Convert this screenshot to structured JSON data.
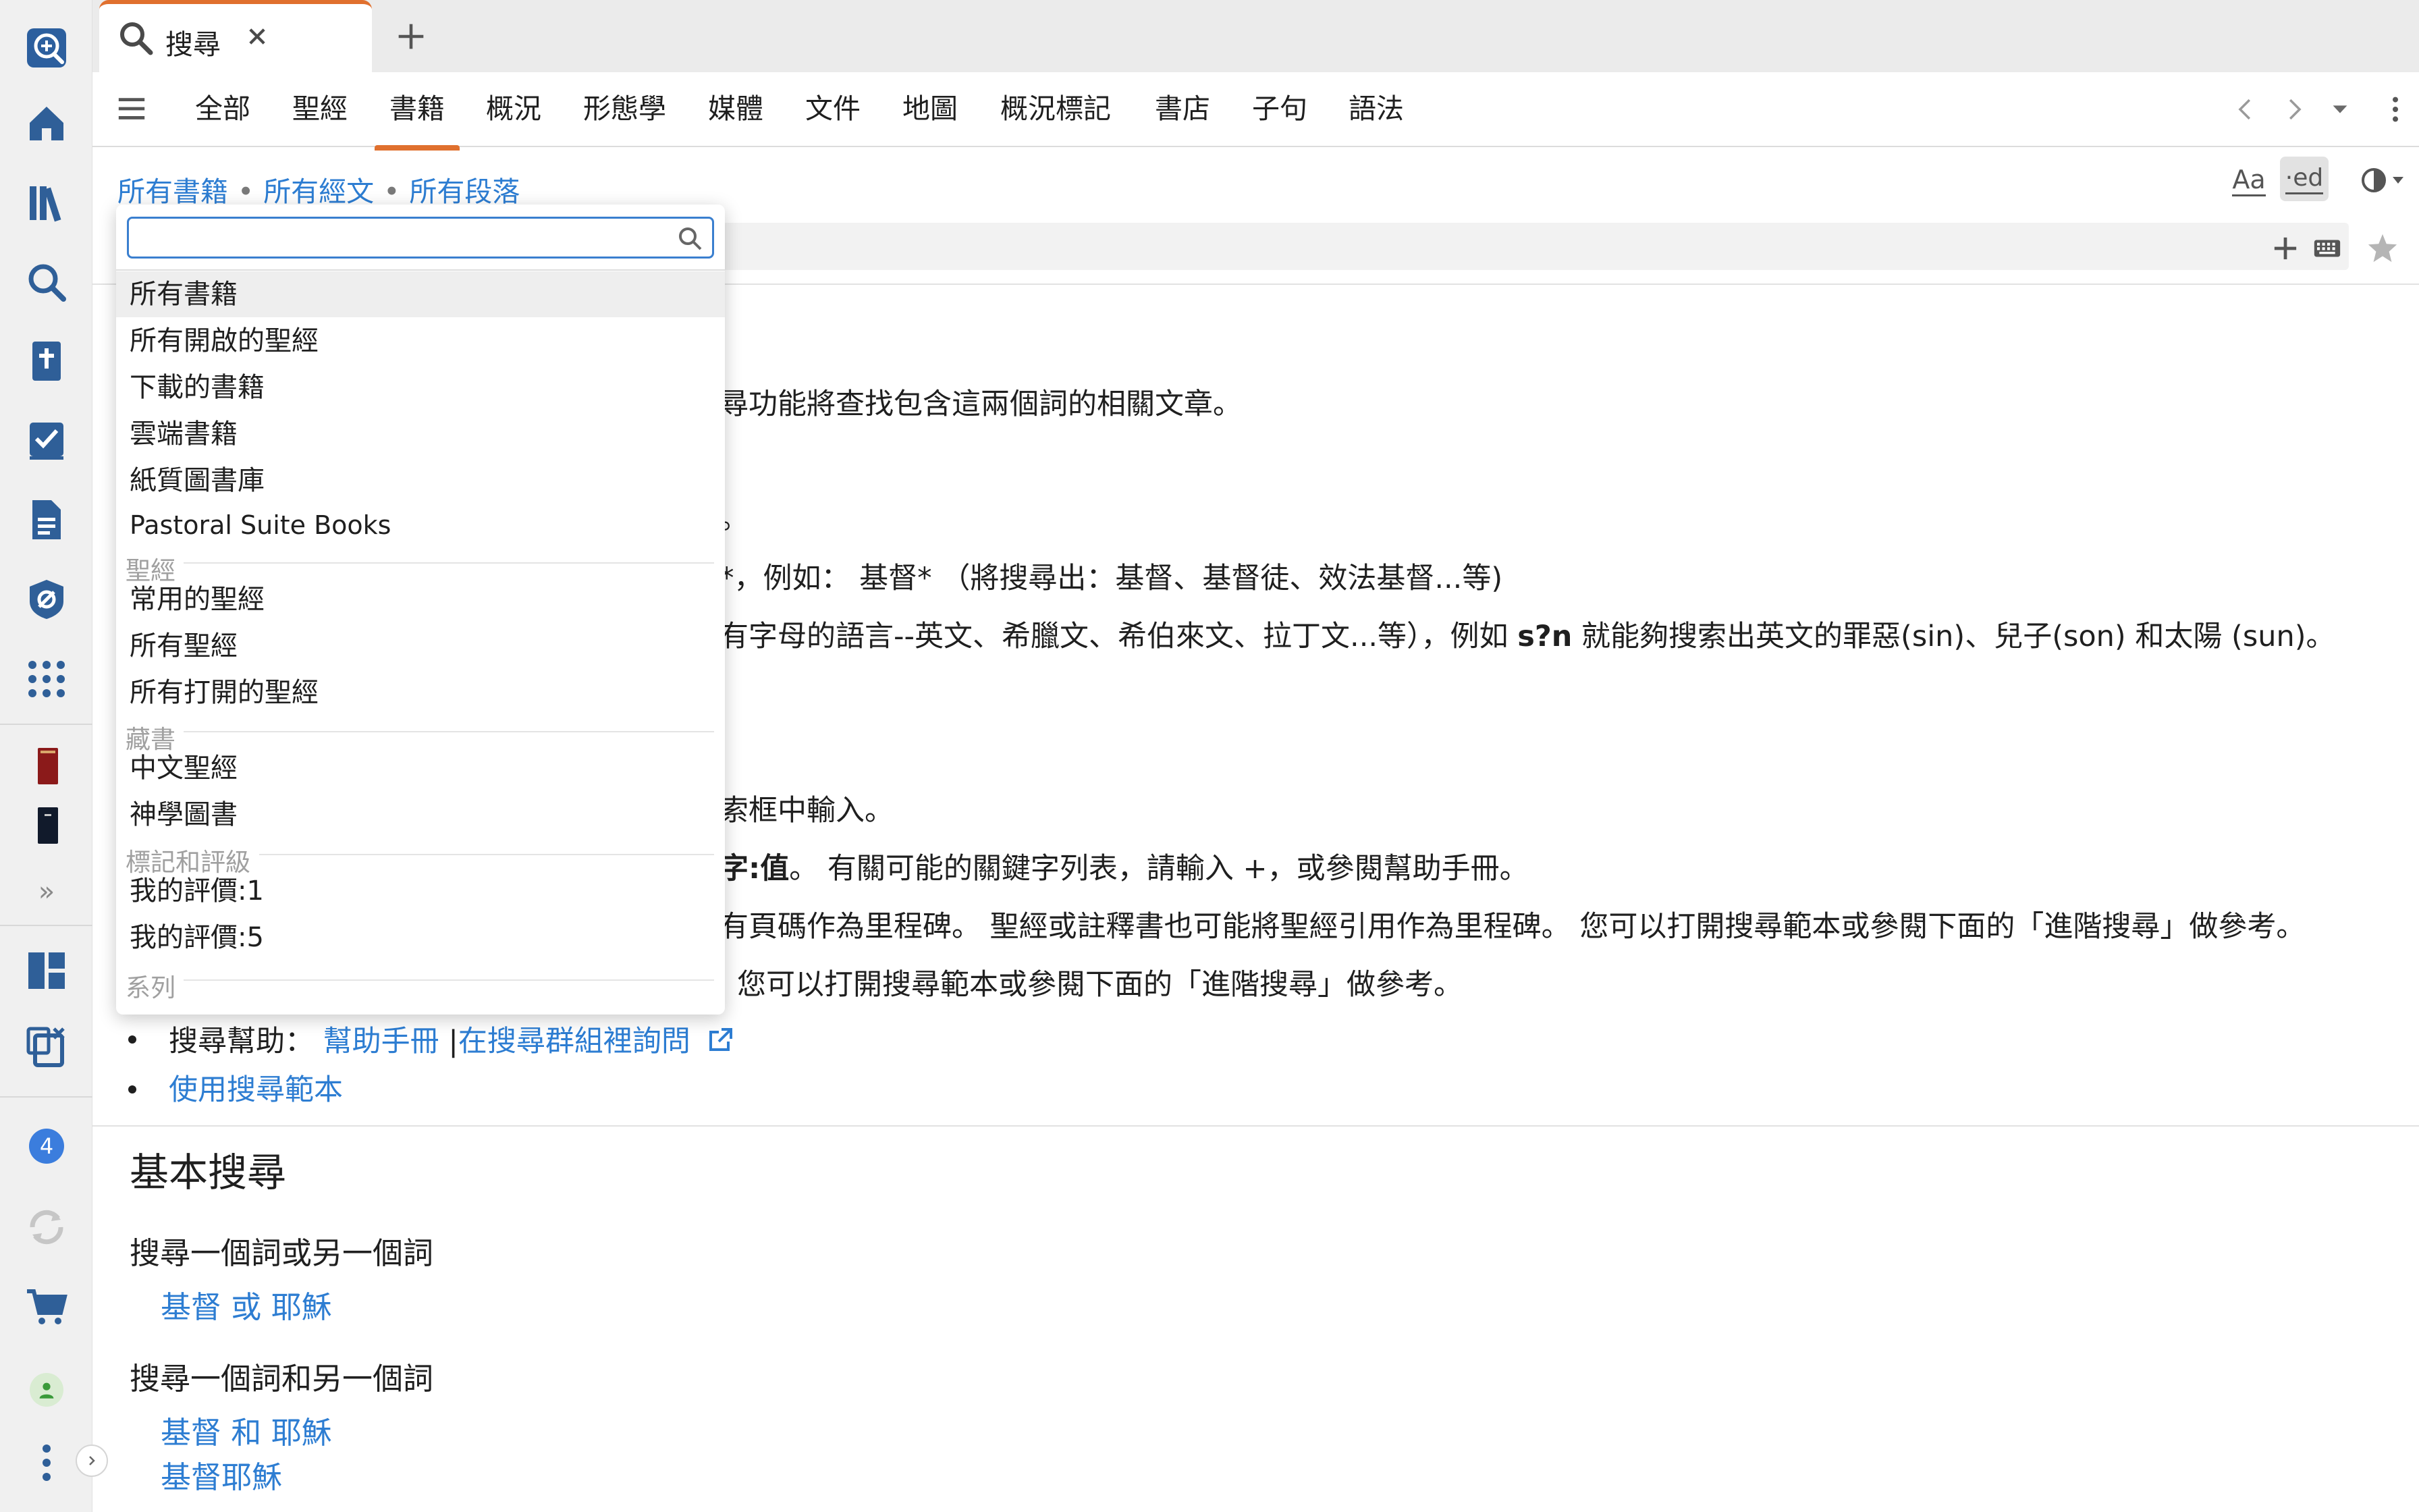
{
  "tab": {
    "search_label": "搜尋",
    "close_icon": "close-icon",
    "new_tab_icon": "plus-icon"
  },
  "nav": {
    "tabs": [
      "全部",
      "聖經",
      "書籍",
      "概況",
      "形態學",
      "媒體",
      "文件",
      "地圖",
      "概況標記",
      "書店",
      "子句",
      "語法"
    ],
    "active_index": 2
  },
  "breadcrumb": {
    "items": [
      "所有書籍",
      "所有經文",
      "所有段落"
    ],
    "separator": "•"
  },
  "toolbar": {
    "font_label": "Aa",
    "ed_label": "·ed"
  },
  "sidebar": {
    "notification_count": "4",
    "more_label": "»"
  },
  "dropdown": {
    "search_value": "",
    "search_placeholder": "",
    "items_top": [
      "所有書籍",
      "所有開啟的聖經",
      "下載的書籍",
      "雲端書籍",
      "紙質圖書庫",
      "Pastoral Suite Books"
    ],
    "group_bible": "聖經",
    "items_bible": [
      "常用的聖經",
      "所有聖經",
      "所有打開的聖經"
    ],
    "group_collections": "藏書",
    "items_collections": [
      "中文聖經",
      "神學圖書"
    ],
    "group_ratings": "標記和評級",
    "items_ratings": [
      "我的評價:1",
      "我的評價:5"
    ],
    "group_series": "系列"
  },
  "content": {
    "line1": "尋功能將查找包含這兩個詞的相關文章。",
    "line2": "。",
    "line3": "*，例如： 基督* （將搜尋出：基督、基督徒、效法基督...等)",
    "line4_pre": "有字母的語言--英文、希臘文、希伯來文、拉丁文...等），例如 ",
    "line4_bold": "s?n",
    "line4_post": " 就能夠搜索出英文的罪惡(sin)、兒子(son) 和太陽 (sun)。",
    "line5": "索框中輸入。",
    "line6_bold": "字:值",
    "line6_post": "。 有關可能的關鍵字列表，請輸入 +，或參閱幫助手冊。",
    "line7": "有頁碼作為里程碑。 聖經或註釋書也可能將聖經引用作為里程碑。 您可以打開搜尋範本或參閱下面的「進階搜尋」做參考。",
    "line8": "您可以打開搜尋範本或參閱下面的「進階搜尋」做參考。",
    "help_label": "搜尋幫助：",
    "help_link1": "幫助手冊",
    "help_sep": "|",
    "help_link2": "在搜尋群組裡詢問",
    "use_template": "使用搜尋範本",
    "section_title": "基本搜尋",
    "or_heading": "搜尋一個詞或另一個詞",
    "or_example": "基督 或 耶穌",
    "and_heading": "搜尋一個詞和另一個詞",
    "and_example1": "基督 和 耶穌",
    "and_example2": "基督耶穌"
  },
  "colors": {
    "accent": "#e0702e",
    "link": "#2d7dd2",
    "badge": "#3b7ddd"
  }
}
